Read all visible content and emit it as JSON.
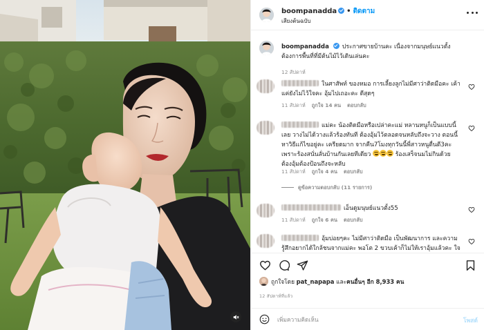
{
  "colors": {
    "accent": "#0095f6",
    "verified": "#3897f0",
    "muted": "#8e8e8e",
    "text": "#262626",
    "post_disabled": "#b2dffc"
  },
  "media": {
    "mute_icon": "speaker-muted-icon"
  },
  "header": {
    "username": "boompanadda",
    "separator": "•",
    "follow_label": "ติดตาม",
    "audio": "เสียงต้นฉบับ",
    "more_icon": "more-horizontal-icon"
  },
  "caption": {
    "username": "boompanadda",
    "text": "ประกาศขายบ้านคะ เนื่องจากมนุษย์แนวตั้งต้องการพื้นที่ที่มีต้นไม้ไว้เดินเล่นคะ",
    "time": "12 สัปดาห์"
  },
  "comments": [
    {
      "text": "ในศาสัพท์ ของหมอ การเลี้ยงลูกไม่มีศาว่าติดมือคะ เค้าแค่ยังไม่ไว้ใจคะ อุ้มไปเถอะคะ ดีสุดๆ",
      "time": "11 สัปดาห์",
      "likes": "ถูกใจ 14 คน",
      "reply": "ตอบกลับ"
    },
    {
      "text": "แม่คะ น้องติดมือหรือเปล่าคะแม่ หลานหนูก็เป็นแบบนี้เลย วางไม่ได้วางแล้วร้องทันที ต้องอุ้มไว้ตลอดจนหลับถึงจะวาง ตอนนี้หาวิธีแก้ไขอยู่คะ เครียดมาก จากคืน7โมงทุกวันนี้พี่สาวหนูตื่นตี3คะ เพราะร้องสนั่นลั่นบ้านกันเลยทีเดียว",
      "text_after": "ร้องเสร็จนมไม่กินด้วย ต้องอุ้มต้องป้อนถึงจะหลับ",
      "time": "11 สัปดาห์",
      "likes": "ถูกใจ 4 คน",
      "reply": "ตอบกลับ",
      "view_replies": "ดูข้อความตอบกลับ (11 รายการ)"
    },
    {
      "text": "เอ็นดูมนุษย์แนวตั้ง55",
      "time": "11 สัปดาห์",
      "likes": "ถูกใจ 6 คน",
      "reply": "ตอบกลับ"
    },
    {
      "text": "อุ้มบ่อยๆคะ ไม่มีศาว่าติดมือ เป็นพัฒนาการ และความรู้สึกอยากได้ใกล้ชนจากแม่คะ พอโต 2 ขวบเค้าก็ไม่ให้เราอุ้มแล้วคะ ใจ",
      "time": "",
      "likes": "",
      "reply": ""
    }
  ],
  "actions": {
    "like_icon": "heart-icon",
    "comment_icon": "comment-icon",
    "share_icon": "paper-plane-icon",
    "save_icon": "bookmark-icon"
  },
  "likes_line": {
    "prefix": "ถูกใจโดย",
    "user": "pat_napapa",
    "middle": "และ",
    "others": "คนอื่นๆ อีก 8,933 คน"
  },
  "timestamp": "12 สัปดาห์ที่แล้ว",
  "composer": {
    "emoji_icon": "emoji-smile-icon",
    "placeholder": "เพิ่มความคิดเห็น",
    "post_label": "โพสต์"
  }
}
